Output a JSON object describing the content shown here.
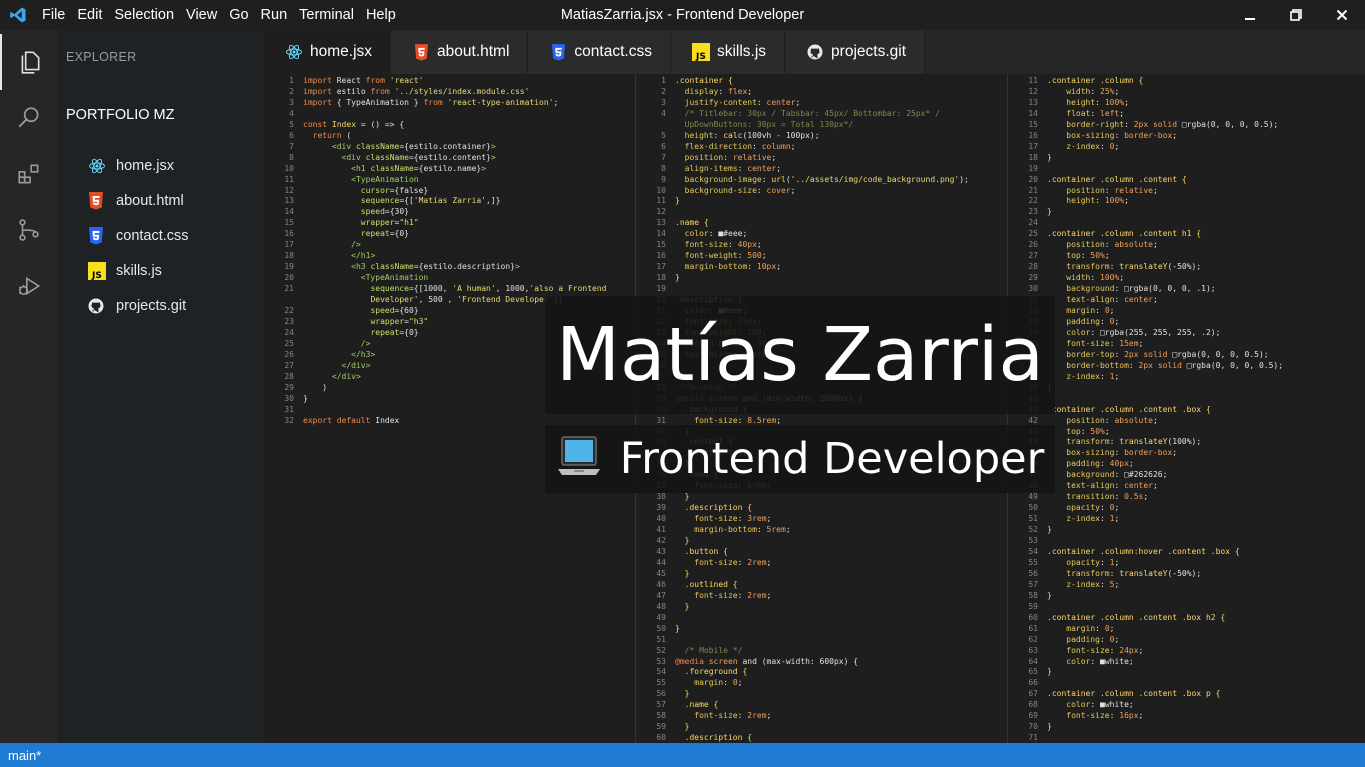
{
  "window": {
    "title": "MatiasZarria.jsx - Frontend Developer",
    "menu": [
      "File",
      "Edit",
      "Selection",
      "View",
      "Go",
      "Run",
      "Terminal",
      "Help"
    ]
  },
  "sidebar": {
    "explorer_title": "EXPLORER",
    "folder": "PORTFOLIO MZ",
    "files": [
      {
        "label": "home.jsx",
        "icon": "react-icon"
      },
      {
        "label": "about.html",
        "icon": "html5-icon"
      },
      {
        "label": "contact.css",
        "icon": "css3-icon"
      },
      {
        "label": "skills.js",
        "icon": "javascript-icon"
      },
      {
        "label": "projects.git",
        "icon": "github-icon"
      }
    ]
  },
  "tabs": [
    {
      "label": "home.jsx",
      "icon": "react-icon",
      "active": true
    },
    {
      "label": "about.html",
      "icon": "html5-icon",
      "active": false
    },
    {
      "label": "contact.css",
      "icon": "css3-icon",
      "active": false
    },
    {
      "label": "skills.js",
      "icon": "javascript-icon",
      "active": false
    },
    {
      "label": "projects.git",
      "icon": "github-icon",
      "active": false
    }
  ],
  "overlay": {
    "name": "Matías Zarria",
    "role": "Frontend Developer",
    "role_icon": "laptop-icon"
  },
  "statusbar": {
    "branch": "main*"
  },
  "colors": {
    "accent": "#1f7ad3",
    "react": "#61dafb",
    "html": "#e44d26",
    "css": "#2965f1",
    "js": "#f7df1e"
  }
}
